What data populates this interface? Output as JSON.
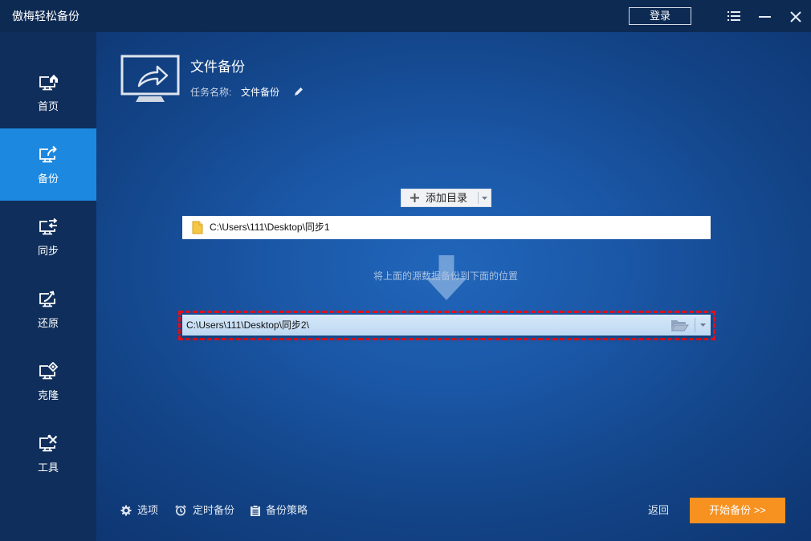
{
  "window": {
    "title": "傲梅轻松备份",
    "login_label": "登录",
    "menu_icon": "menu-icon",
    "minimize_icon": "minimize-icon",
    "close_icon": "close-icon"
  },
  "sidebar": {
    "items": [
      {
        "label": "首页",
        "icon": "home-icon",
        "active": false
      },
      {
        "label": "备份",
        "icon": "backup-icon",
        "active": true
      },
      {
        "label": "同步",
        "icon": "sync-icon",
        "active": false
      },
      {
        "label": "还原",
        "icon": "restore-icon",
        "active": false
      },
      {
        "label": "克隆",
        "icon": "clone-icon",
        "active": false
      },
      {
        "label": "工具",
        "icon": "tools-icon",
        "active": false
      }
    ]
  },
  "header": {
    "title": "文件备份",
    "task_name_label": "任务名称:",
    "task_name_value": "文件备份",
    "icon": "file-backup-monitor-icon",
    "edit_icon": "pencil-icon"
  },
  "source": {
    "add_button_label": "添加目录",
    "path": "C:\\Users\\111\\Desktop\\同步1",
    "icon": "folder-icon"
  },
  "transfer_hint": "将上面的源数据备份到下面的位置",
  "destination": {
    "path": "C:\\Users\\111\\Desktop\\同步2\\",
    "browse_icon": "folder-open-icon"
  },
  "footer": {
    "options_label": "选项",
    "schedule_label": "定时备份",
    "scheme_label": "备份策略",
    "back_label": "返回",
    "start_label": "开始备份 >>"
  },
  "colors": {
    "active_nav": "#1d88df",
    "start_button": "#f7911f",
    "highlight_border": "#e3101c"
  }
}
